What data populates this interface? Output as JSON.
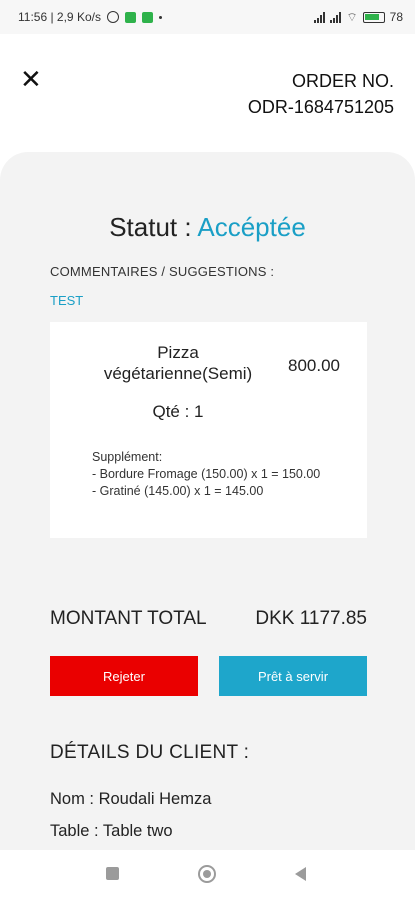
{
  "status_bar": {
    "time_speed": "11:56 | 2,9 Ko/s",
    "battery": "78"
  },
  "header": {
    "close_icon": "close-icon",
    "order_label": "ORDER NO.",
    "order_number": "ODR-1684751205"
  },
  "order": {
    "status_label": "Statut : ",
    "status_value": "Accéptée",
    "comments_label": "COMMENTAIRES / SUGGESTIONS :",
    "comments_value": "TEST",
    "item": {
      "name": "Pizza végétarienne(Semi)",
      "price": "800.00",
      "quantity": "Qté : 1",
      "supplement_title": "Supplément:",
      "supplement_lines": [
        "- Bordure Fromage (150.00) x 1 = 150.00",
        "- Gratiné (145.00) x 1 = 145.00"
      ]
    },
    "total_label": "MONTANT TOTAL",
    "total_value": "DKK 1177.85"
  },
  "actions": {
    "reject_label": "Rejeter",
    "ready_label": "Prêt à servir"
  },
  "client": {
    "title": "DÉTAILS DU CLIENT :",
    "name_line": "Nom : Roudali Hemza",
    "table_line": "Table : Table two"
  },
  "colors": {
    "accent": "#1a9fc6",
    "reject": "#ea0000",
    "ready": "#1ea6cb"
  }
}
